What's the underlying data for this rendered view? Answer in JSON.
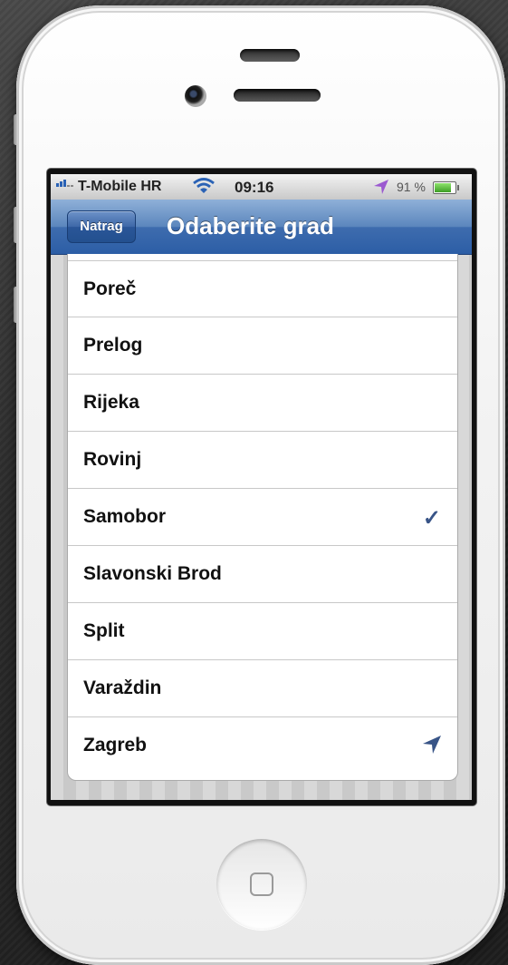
{
  "statusbar": {
    "carrier": "T-Mobile HR",
    "time": "09:16",
    "battery_percent": "91 %",
    "battery_level": 0.91
  },
  "navbar": {
    "back_label": "Natrag",
    "title": "Odaberite grad"
  },
  "cities": [
    {
      "name": "Poreč",
      "selected": false,
      "current_location": false
    },
    {
      "name": "Prelog",
      "selected": false,
      "current_location": false
    },
    {
      "name": "Rijeka",
      "selected": false,
      "current_location": false
    },
    {
      "name": "Rovinj",
      "selected": false,
      "current_location": false
    },
    {
      "name": "Samobor",
      "selected": true,
      "current_location": false
    },
    {
      "name": "Slavonski Brod",
      "selected": false,
      "current_location": false
    },
    {
      "name": "Split",
      "selected": false,
      "current_location": false
    },
    {
      "name": "Varaždin",
      "selected": false,
      "current_location": false
    },
    {
      "name": "Zagreb",
      "selected": false,
      "current_location": true
    }
  ],
  "icons": {
    "selected": "checkmark-icon",
    "current_location": "location-arrow-icon"
  },
  "colors": {
    "navbar": "#3e6cae",
    "checkmark": "#385487"
  }
}
